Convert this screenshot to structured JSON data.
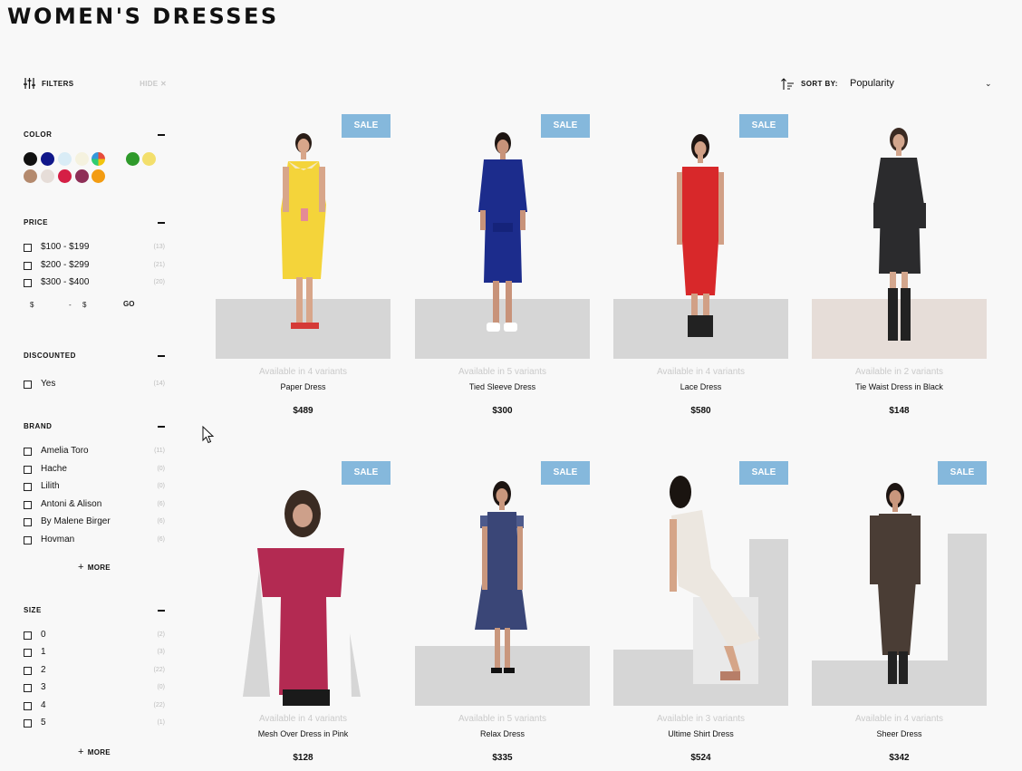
{
  "page": {
    "title": "WOMEN'S DRESSES"
  },
  "filters": {
    "label": "FILTERS",
    "hide_label": "HIDE",
    "color": {
      "title": "COLOR",
      "swatches": [
        "#111111",
        "#10178a",
        "#d9ecf6",
        "#f5f2df",
        "multicolor",
        "#2f9a2b",
        "#f3df6c",
        "#b48a6e",
        "#e6ddd8",
        "#d51f45",
        "#8e2f57",
        "#f39c12"
      ]
    },
    "price": {
      "title": "PRICE",
      "options": [
        {
          "label": "$100 - $199",
          "count": "(13)"
        },
        {
          "label": "$200 - $299",
          "count": "(21)"
        },
        {
          "label": "$300 - $400",
          "count": "(20)"
        }
      ],
      "min_symbol": "$",
      "dash": "-",
      "max_symbol": "$",
      "go_label": "GO"
    },
    "discounted": {
      "title": "DISCOUNTED",
      "options": [
        {
          "label": "Yes",
          "count": "(14)"
        }
      ]
    },
    "brand": {
      "title": "BRAND",
      "options": [
        {
          "label": "Amelia Toro",
          "count": "(11)"
        },
        {
          "label": "Hache",
          "count": "(0)"
        },
        {
          "label": "Lilith",
          "count": "(0)"
        },
        {
          "label": "Antoni & Alison",
          "count": "(6)"
        },
        {
          "label": "By Malene Birger",
          "count": "(6)"
        },
        {
          "label": "Hovman",
          "count": "(6)"
        }
      ],
      "more_label": "MORE"
    },
    "size": {
      "title": "SIZE",
      "options": [
        {
          "label": "0",
          "count": "(2)"
        },
        {
          "label": "1",
          "count": "(3)"
        },
        {
          "label": "2",
          "count": "(22)"
        },
        {
          "label": "3",
          "count": "(0)"
        },
        {
          "label": "4",
          "count": "(22)"
        },
        {
          "label": "5",
          "count": "(1)"
        }
      ],
      "more_label": "MORE"
    }
  },
  "sort": {
    "label": "SORT BY:",
    "value": "Popularity"
  },
  "products": [
    {
      "badge": "SALE",
      "variants": "Available in 4 variants",
      "name": "Paper Dress",
      "price": "$489",
      "dress_color": "#f4d43a"
    },
    {
      "badge": "SALE",
      "variants": "Available in 5 variants",
      "name": "Tied Sleeve Dress",
      "price": "$300",
      "dress_color": "#1c2c8c"
    },
    {
      "badge": "SALE",
      "variants": "Available in 4 variants",
      "name": "Lace Dress",
      "price": "$580",
      "dress_color": "#d8282a"
    },
    {
      "badge": "",
      "variants": "Available in 2 variants",
      "name": "Tie Waist Dress in Black",
      "price": "$148",
      "dress_color": "#2b2b2d"
    },
    {
      "badge": "SALE",
      "variants": "Available in 4 variants",
      "name": "Mesh Over Dress in Pink",
      "price": "$128",
      "dress_color": "#b32a52"
    },
    {
      "badge": "SALE",
      "variants": "Available in 5 variants",
      "name": "Relax Dress",
      "price": "$335",
      "dress_color": "#3a4677"
    },
    {
      "badge": "SALE",
      "variants": "Available in 3 variants",
      "name": "Ultime Shirt Dress",
      "price": "$524",
      "dress_color": "#ece7e0"
    },
    {
      "badge": "SALE",
      "variants": "Available in 4 variants",
      "name": "Sheer Dress",
      "price": "$342",
      "dress_color": "#4a3d35"
    }
  ]
}
